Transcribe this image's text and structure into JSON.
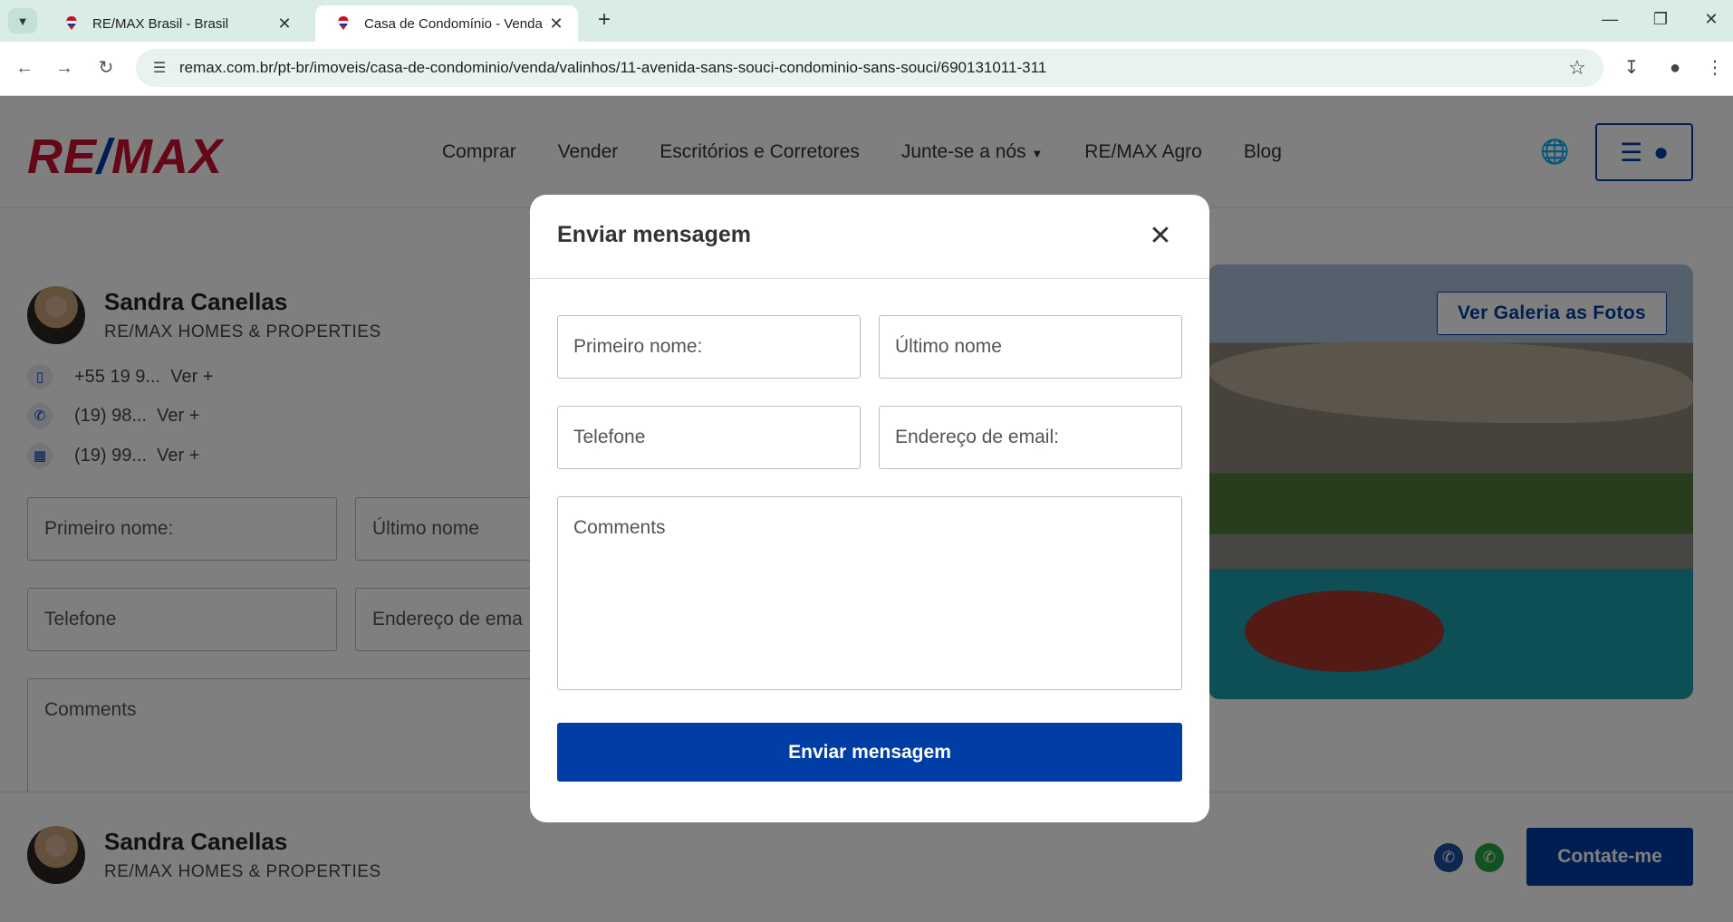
{
  "browser": {
    "tabs": [
      {
        "title": "RE/MAX Brasil - Brasil",
        "active": false
      },
      {
        "title": "Casa de Condomínio - Venda -",
        "active": true
      }
    ],
    "url": "remax.com.br/pt-br/imoveis/casa-de-condominio/venda/valinhos/11-avenida-sans-souci-condominio-sans-souci/690131011-311"
  },
  "site": {
    "logo": {
      "left": "RE",
      "slash": "/",
      "right": "MAX"
    },
    "nav": [
      "Comprar",
      "Vender",
      "Escritórios e Corretores",
      "Junte-se a nós",
      "RE/MAX Agro",
      "Blog"
    ]
  },
  "agent": {
    "name": "Sandra Canellas",
    "company": "RE/MAX HOMES & PROPERTIES",
    "phones": [
      {
        "number": "+55 19 9...",
        "more": "Ver +",
        "icon": "mobile-icon"
      },
      {
        "number": "(19) 98...",
        "more": "Ver +",
        "icon": "phone-icon"
      },
      {
        "number": "(19) 99...",
        "more": "Ver +",
        "icon": "office-icon"
      }
    ]
  },
  "background_form": {
    "first_name": "Primeiro nome:",
    "last_name": "Último nome",
    "phone": "Telefone",
    "email": "Endereço de ema",
    "comments": "Comments"
  },
  "gallery_button": "Ver Galeria as Fotos",
  "footer": {
    "name": "Sandra Canellas",
    "company": "RE/MAX HOMES & PROPERTIES",
    "contact_button": "Contate-me"
  },
  "modal": {
    "title": "Enviar mensagem",
    "first_name_placeholder": "Primeiro nome:",
    "last_name_placeholder": "Último nome",
    "phone_placeholder": "Telefone",
    "email_placeholder": "Endereço de email:",
    "comments_placeholder": "Comments",
    "submit_label": "Enviar mensagem"
  },
  "colors": {
    "brand_blue": "#003da5",
    "brand_red": "#c8102e"
  }
}
